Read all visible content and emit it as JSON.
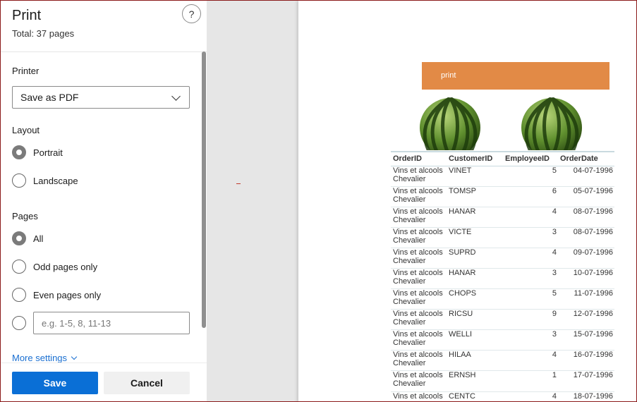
{
  "panel": {
    "title": "Print",
    "total": "Total: 37 pages",
    "help": "?"
  },
  "printer": {
    "label": "Printer",
    "selected": "Save as PDF"
  },
  "layout": {
    "label": "Layout",
    "options": [
      "Portrait",
      "Landscape"
    ],
    "selected": "Portrait"
  },
  "pages": {
    "label": "Pages",
    "options": [
      "All",
      "Odd pages only",
      "Even pages only"
    ],
    "selected": "All",
    "range_placeholder": "e.g. 1-5, 8, 11-13"
  },
  "more_settings": "More settings",
  "buttons": {
    "save": "Save",
    "cancel": "Cancel"
  },
  "preview": {
    "banner_text": "print",
    "columns": [
      "OrderID",
      "CustomerID",
      "EmployeeID",
      "OrderDate"
    ],
    "rows": [
      {
        "order": "Vins et alcools Chevalier",
        "customer": "VINET",
        "employee": "5",
        "date": "04-07-1996"
      },
      {
        "order": "Vins et alcools Chevalier",
        "customer": "TOMSP",
        "employee": "6",
        "date": "05-07-1996"
      },
      {
        "order": "Vins et alcools Chevalier",
        "customer": "HANAR",
        "employee": "4",
        "date": "08-07-1996"
      },
      {
        "order": "Vins et alcools Chevalier",
        "customer": "VICTE",
        "employee": "3",
        "date": "08-07-1996"
      },
      {
        "order": "Vins et alcools Chevalier",
        "customer": "SUPRD",
        "employee": "4",
        "date": "09-07-1996"
      },
      {
        "order": "Vins et alcools Chevalier",
        "customer": "HANAR",
        "employee": "3",
        "date": "10-07-1996"
      },
      {
        "order": "Vins et alcools Chevalier",
        "customer": "CHOPS",
        "employee": "5",
        "date": "11-07-1996"
      },
      {
        "order": "Vins et alcools Chevalier",
        "customer": "RICSU",
        "employee": "9",
        "date": "12-07-1996"
      },
      {
        "order": "Vins et alcools Chevalier",
        "customer": "WELLI",
        "employee": "3",
        "date": "15-07-1996"
      },
      {
        "order": "Vins et alcools Chevalier",
        "customer": "HILAA",
        "employee": "4",
        "date": "16-07-1996"
      },
      {
        "order": "Vins et alcools Chevalier",
        "customer": "ERNSH",
        "employee": "1",
        "date": "17-07-1996"
      },
      {
        "order": "Vins et alcools Chevalier",
        "customer": "CENTC",
        "employee": "4",
        "date": "18-07-1996"
      }
    ]
  },
  "colors": {
    "save_button": "#0a6fd6",
    "link": "#1a6fd1",
    "banner": "#e28a46"
  }
}
